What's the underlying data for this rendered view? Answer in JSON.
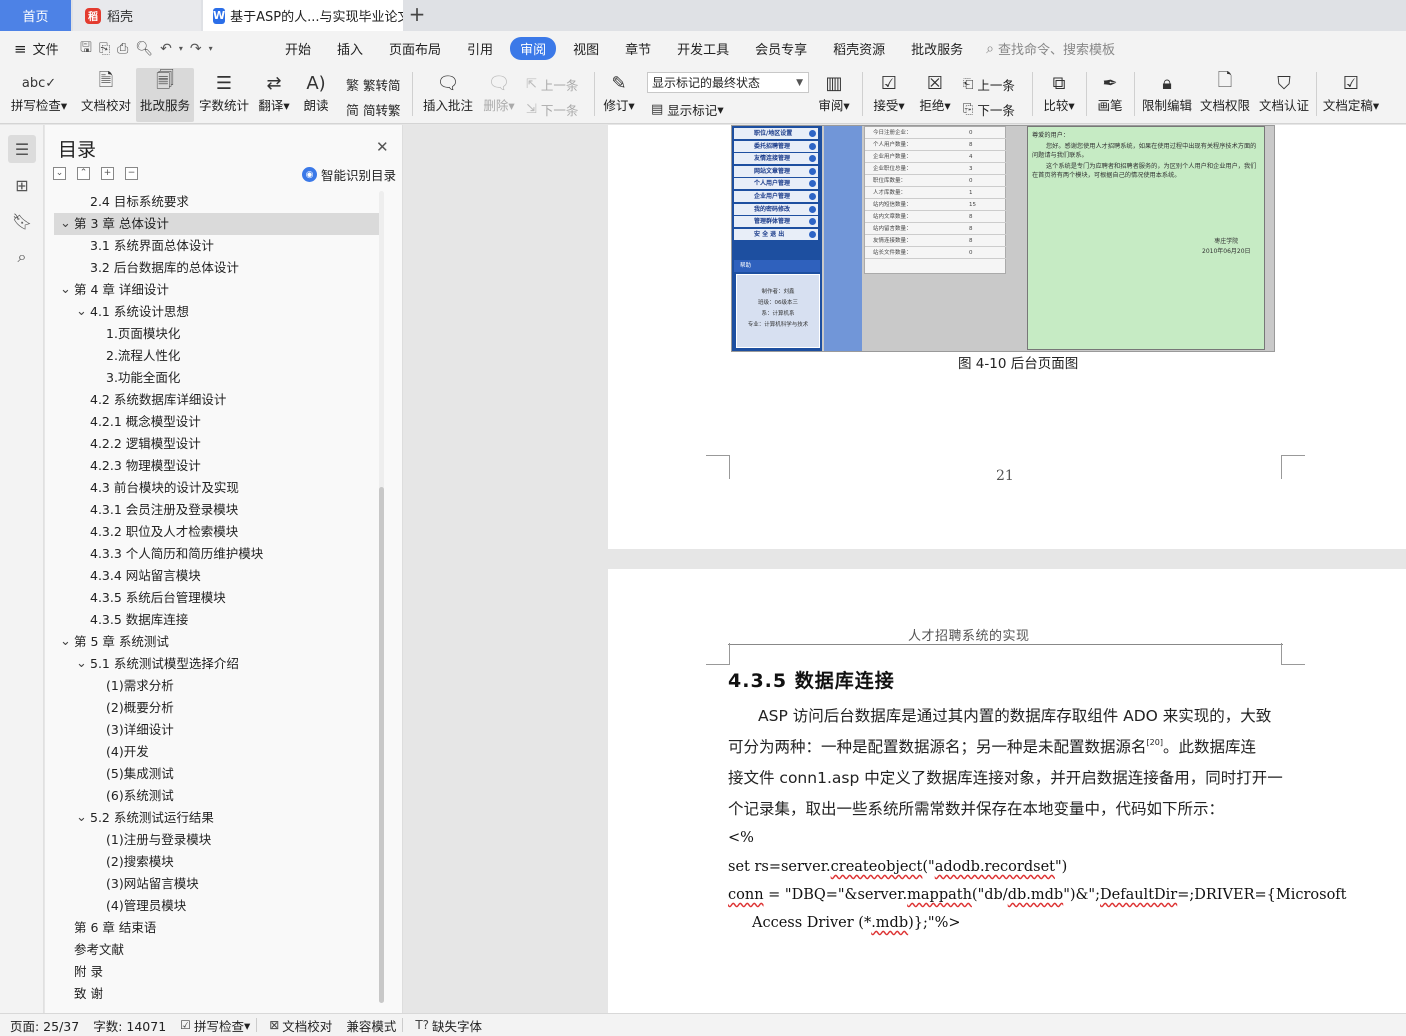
{
  "tabs": {
    "home": "首页",
    "daoke": "稻壳",
    "document": "基于ASP的人...与实现毕业论文"
  },
  "menu": {
    "file": "文件",
    "items": [
      "开始",
      "插入",
      "页面布局",
      "引用",
      "审阅",
      "视图",
      "章节",
      "开发工具",
      "会员专享",
      "稻壳资源",
      "批改服务"
    ],
    "active": "审阅",
    "search_placeholder": "查找命令、搜索模板"
  },
  "ribbon": {
    "spell_check": "拼写检查",
    "doc_proof": "文档校对",
    "correction_service": "批改服务",
    "word_count": "字数统计",
    "translate": "翻译",
    "read_aloud": "朗读",
    "trad_to_simp": "繁转简",
    "simp_to_trad": "简转繁",
    "insert_comment": "插入批注",
    "delete": "删除",
    "prev_comment": "上一条",
    "next_comment": "下一条",
    "revise": "修订",
    "markup_state": "显示标记的最终状态",
    "show_markup": "显示标记",
    "review": "审阅",
    "accept": "接受",
    "reject": "拒绝",
    "prev_change": "上一条",
    "next_change": "下一条",
    "compare": "比较",
    "pen": "画笔",
    "restrict_edit": "限制编辑",
    "doc_permission": "文档权限",
    "doc_certify": "文档认证",
    "doc_finalize": "文档定稿"
  },
  "toc": {
    "title": "目录",
    "smart": "智能识别目录",
    "items": [
      {
        "text": "2.4 目标系统要求",
        "level": 2,
        "caret": ""
      },
      {
        "text": "第 3 章  总体设计",
        "level": 1,
        "caret": "v",
        "selected": true
      },
      {
        "text": "3.1 系统界面总体设计",
        "level": 2,
        "caret": ""
      },
      {
        "text": "3.2  后台数据库的总体设计",
        "level": 2,
        "caret": ""
      },
      {
        "text": "第 4 章  详细设计",
        "level": 1,
        "caret": "v"
      },
      {
        "text": "4.1 系统设计思想",
        "level": 2,
        "caret": "v"
      },
      {
        "text": "1.页面模块化",
        "level": 3,
        "caret": ""
      },
      {
        "text": "2.流程人性化",
        "level": 3,
        "caret": ""
      },
      {
        "text": "3.功能全面化",
        "level": 3,
        "caret": ""
      },
      {
        "text": "4.2 系统数据库详细设计",
        "level": 2,
        "caret": ""
      },
      {
        "text": "4.2.1 概念模型设计",
        "level": 2,
        "caret": ""
      },
      {
        "text": "4.2.2 逻辑模型设计",
        "level": 2,
        "caret": ""
      },
      {
        "text": "4.2.3 物理模型设计",
        "level": 2,
        "caret": ""
      },
      {
        "text": "4.3 前台模块的设计及实现",
        "level": 2,
        "caret": ""
      },
      {
        "text": "4.3.1 会员注册及登录模块",
        "level": 2,
        "caret": ""
      },
      {
        "text": "4.3.2 职位及人才检索模块",
        "level": 2,
        "caret": ""
      },
      {
        "text": "4.3.3 个人简历和简历维护模块",
        "level": 2,
        "caret": ""
      },
      {
        "text": "4.3.4 网站留言模块",
        "level": 2,
        "caret": ""
      },
      {
        "text": "4.3.5 系统后台管理模块",
        "level": 2,
        "caret": ""
      },
      {
        "text": "4.3.5 数据库连接",
        "level": 2,
        "caret": ""
      },
      {
        "text": "第 5 章  系统测试",
        "level": 1,
        "caret": "v"
      },
      {
        "text": "5.1 系统测试模型选择介绍",
        "level": 2,
        "caret": "v"
      },
      {
        "text": "(1)需求分析",
        "level": 3,
        "caret": ""
      },
      {
        "text": "(2)概要分析",
        "level": 3,
        "caret": ""
      },
      {
        "text": "(3)详细设计",
        "level": 3,
        "caret": ""
      },
      {
        "text": "(4)开发",
        "level": 3,
        "caret": ""
      },
      {
        "text": "(5)集成测试",
        "level": 3,
        "caret": ""
      },
      {
        "text": "(6)系统测试",
        "level": 3,
        "caret": ""
      },
      {
        "text": "5.2 系统测试运行结果",
        "level": 2,
        "caret": "v"
      },
      {
        "text": "(1)注册与登录模块",
        "level": 3,
        "caret": ""
      },
      {
        "text": "(2)搜索模块",
        "level": 3,
        "caret": ""
      },
      {
        "text": "(3)网站留言模块",
        "level": 3,
        "caret": ""
      },
      {
        "text": "(4)管理员模块",
        "level": 3,
        "caret": ""
      },
      {
        "text": "第 6 章 结束语",
        "level": 1,
        "caret": ""
      },
      {
        "text": "参考文献",
        "level": 1,
        "caret": ""
      },
      {
        "text": "附  录",
        "level": 1,
        "caret": ""
      },
      {
        "text": "致  谢",
        "level": 1,
        "caret": ""
      }
    ]
  },
  "figure": {
    "nav_items": [
      "职位/地区设置",
      "委托招聘管理",
      "友情连接管理",
      "网站文章管理",
      "个人用户管理",
      "企业用户管理",
      "我的密码修改",
      "管理群体管理",
      "安 全 退 出"
    ],
    "nav_head": "帮助",
    "nav_info": [
      "制作者：刘鑫",
      "班级：06级本三",
      "系：计算机系",
      "专业：计算机科学与技术"
    ],
    "table_rows": [
      {
        "k": "今日注册企业：",
        "v": "0"
      },
      {
        "k": "个人用户数量：",
        "v": "8"
      },
      {
        "k": "企业用户数量：",
        "v": "4"
      },
      {
        "k": "企业职位总量：",
        "v": "3"
      },
      {
        "k": "职位库数量：",
        "v": "0"
      },
      {
        "k": "人才库数量：",
        "v": "1"
      },
      {
        "k": "站内短信数量：",
        "v": "15"
      },
      {
        "k": "站内文章数量：",
        "v": "8"
      },
      {
        "k": "站内留言数量：",
        "v": "8"
      },
      {
        "k": "友情连接数量：",
        "v": "8"
      },
      {
        "k": "站长文件数量：",
        "v": "0"
      }
    ],
    "green_text": [
      "尊爱的用户：",
      "您好。感谢您使用人才招聘系统，如果在使用过程中出现有关程序技术方面的问题请与我们联系。",
      "这个系统是专门为应聘者和招聘者服务的，为区别个人用户和企业用户，我们在首页将有两个模块，可根据自己的情况使用本系统。"
    ],
    "sign": [
      "枣庄学院",
      "2010年06月20日"
    ],
    "caption": "图 4-10 后台页面图"
  },
  "page1": {
    "number": "21"
  },
  "page2": {
    "header": "人才招聘系统的实现",
    "heading": "4.3.5 数据库连接",
    "lines": [
      "ASP 访问后台数据库是通过其内置的数据库存取组件 ADO 来实现的，大致",
      "可分为两种：一种是配置数据源名；另一种是未配置数据源名",
      "。此数据库连",
      "接文件 conn1.asp 中定义了数据库连接对象，并开启数据连接备用，同时打开一",
      "个记录集，取出一些系统所需常数并保存在本地变量中，代码如下所示："
    ],
    "citation": "[20]",
    "code": [
      "<%",
      "set rs=server.createobject(\"adodb.recordset\")",
      "conn = \"DBQ=\"&server.mappath(\"db/db.mdb\")&\";DefaultDir=;DRIVER={Microsoft",
      "Access Driver (*.mdb)};\"%>"
    ]
  },
  "status": {
    "page": "页面: 25/37",
    "words": "字数: 14071",
    "spell": "拼写检查",
    "proof": "文档校对",
    "compat": "兼容模式",
    "missing_font": "缺失字体"
  }
}
